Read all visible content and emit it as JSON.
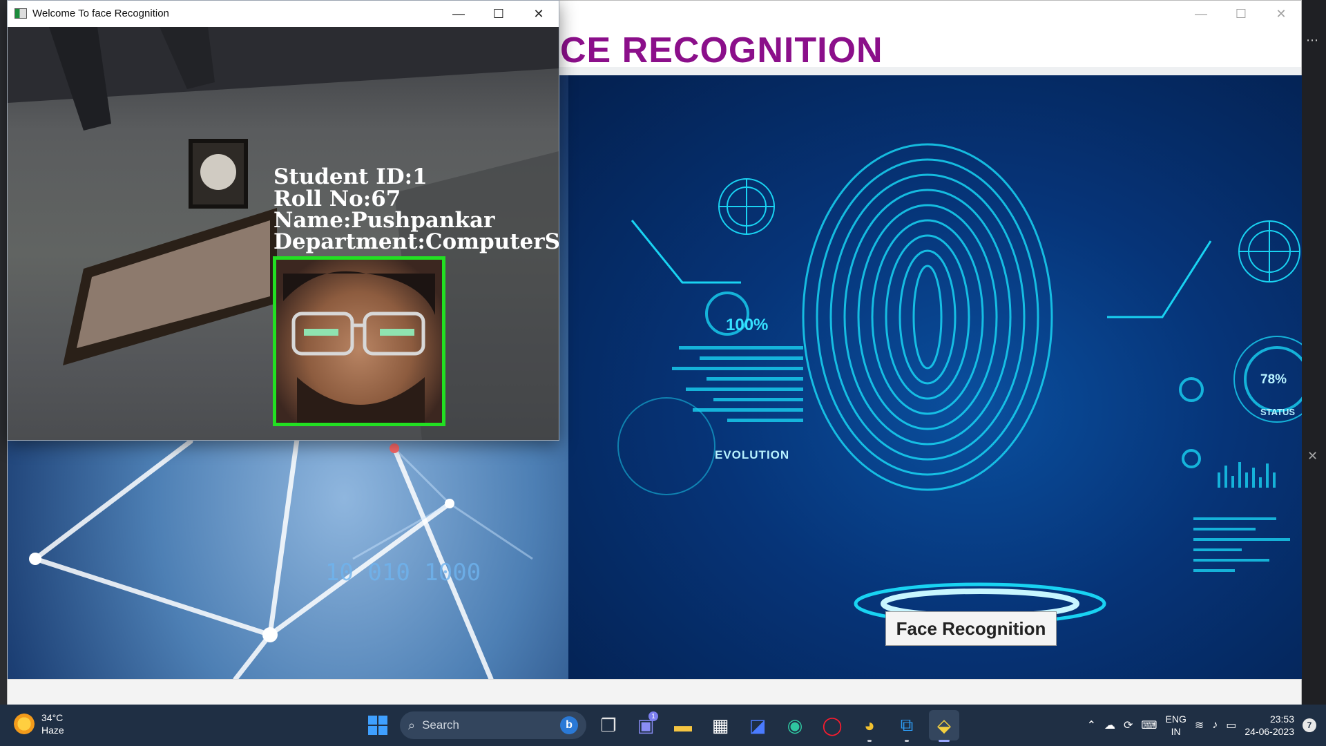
{
  "main_window": {
    "title_visible": "CE RECOGNITION",
    "controls": {
      "minimize": "—",
      "maximize": "☐",
      "close": "✕"
    },
    "binary_text": "10 010  1000",
    "button_label": "Face Recognition",
    "hud_labels": {
      "percent_a": "100%",
      "evolution": "EVOLUTION",
      "percent_b": "78%",
      "status": "STATUS"
    }
  },
  "camera_window": {
    "title": "Welcome To face Recognition",
    "controls": {
      "minimize": "—",
      "maximize": "☐",
      "close": "✕"
    },
    "overlay": {
      "student_id": "Student ID:1",
      "roll_no": "Roll No:67",
      "name": "Name:Pushpankar",
      "department": "Department:ComputerSc"
    },
    "box_color": "#22e022"
  },
  "taskbar": {
    "weather": {
      "temp": "34°C",
      "condition": "Haze"
    },
    "search_placeholder": "Search",
    "chat_badge": "1",
    "tray": {
      "lang_top": "ENG",
      "lang_bottom": "IN",
      "time": "23:53",
      "date": "24-06-2023",
      "notifications": "7"
    }
  },
  "colors": {
    "title_purple": "#8b0f8a",
    "taskbar": "#1f2f44",
    "hud_cyan": "#19d3f2"
  }
}
